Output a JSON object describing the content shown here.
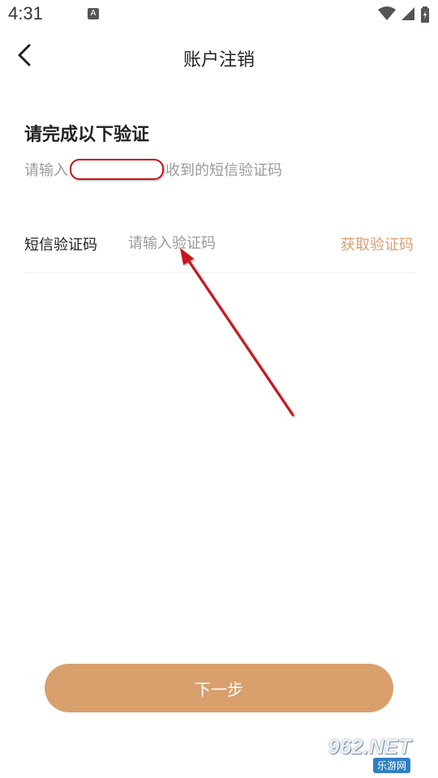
{
  "status_bar": {
    "time": "4:31",
    "notif_letter": "A"
  },
  "header": {
    "title": "账户注销"
  },
  "verify": {
    "heading": "请完成以下验证",
    "sub_prefix": "请输入",
    "sub_suffix": "收到的短信验证码"
  },
  "code_field": {
    "label": "短信验证码",
    "placeholder": "请输入验证码",
    "value": "",
    "get_code_label": "获取验证码"
  },
  "next_button": {
    "label": "下一步"
  },
  "watermark": {
    "top": "962.NET",
    "bottom": "乐游网"
  },
  "colors": {
    "accent": "#d99f6d",
    "link": "#d9a071",
    "annotation": "#c4161c"
  }
}
